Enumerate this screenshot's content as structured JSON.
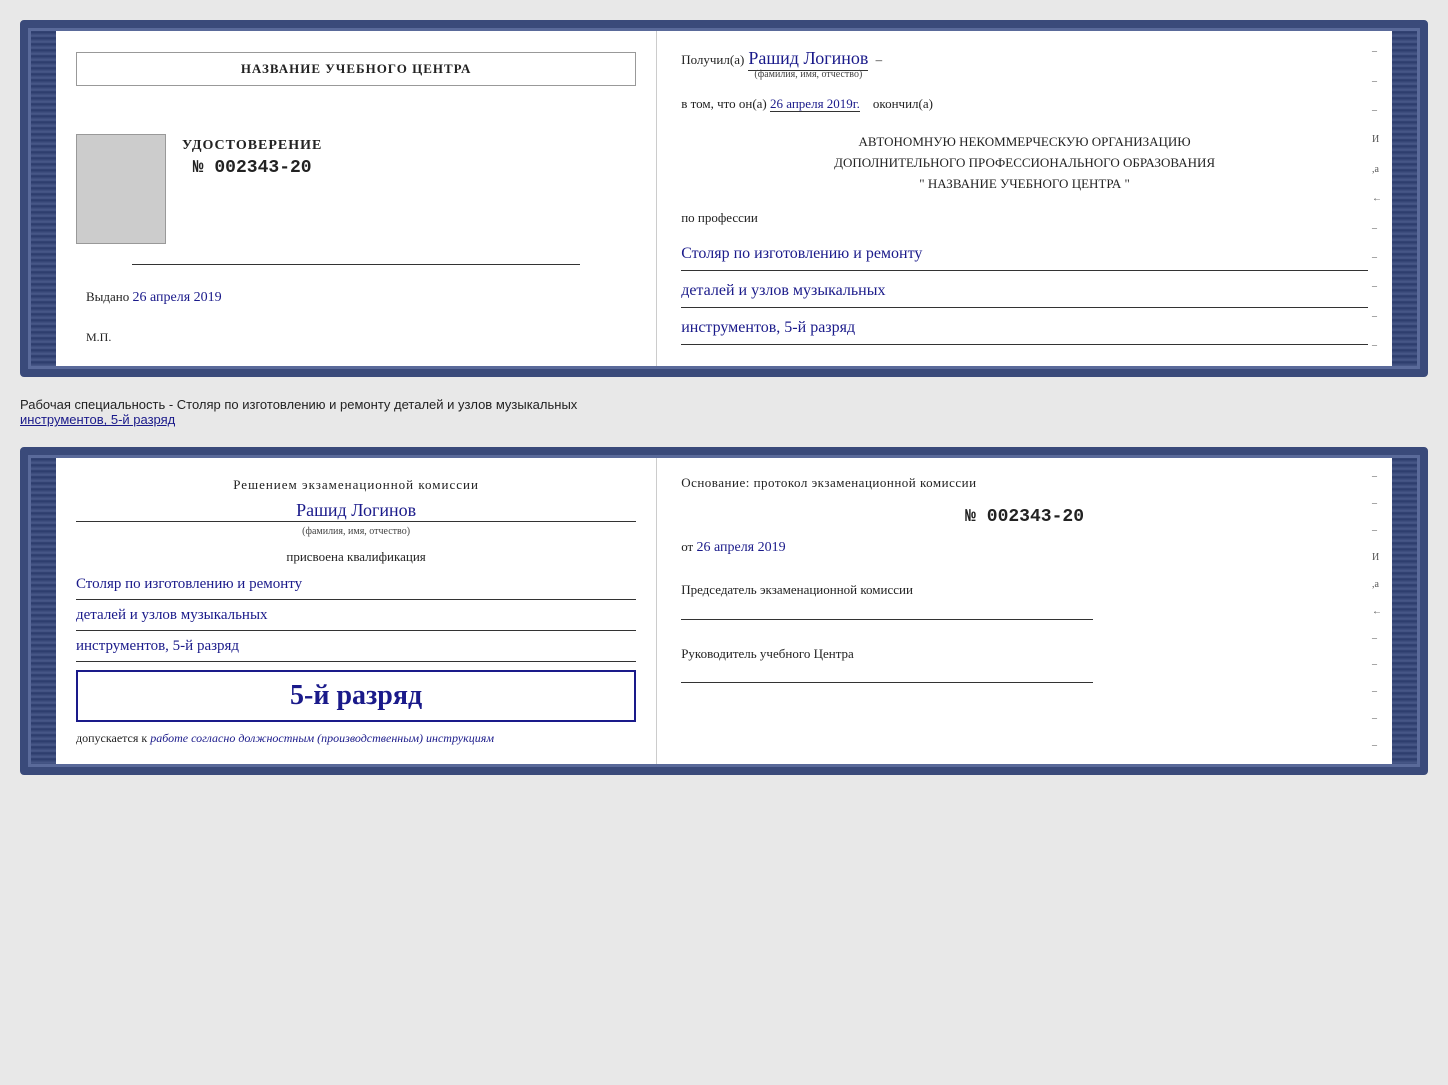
{
  "cert1": {
    "left": {
      "center_name": "НАЗВАНИЕ УЧЕБНОГО ЦЕНТРА",
      "udost_title": "УДОСТОВЕРЕНИЕ",
      "udost_number": "№ 002343-20",
      "vydano_label": "Выдано",
      "vydano_date": "26 апреля 2019",
      "mp": "М.П."
    },
    "right": {
      "poluchil_label": "Получил(а)",
      "name_handwritten": "Рашид Логинов",
      "fio_sub": "(фамилия, имя, отчество)",
      "vtom_label": "в том, что он(а)",
      "date_handwritten": "26 апреля 2019г.",
      "okonchil": "окончил(а)",
      "org_line1": "АВТОНОМНУЮ НЕКОММЕРЧЕСКУЮ ОРГАНИЗАЦИЮ",
      "org_line2": "ДОПОЛНИТЕЛЬНОГО ПРОФЕССИОНАЛЬНОГО ОБРАЗОВАНИЯ",
      "org_line3": "\"   НАЗВАНИЕ УЧЕБНОГО ЦЕНТРА   \"",
      "po_professii": "по профессии",
      "qual1": "Столяр по изготовлению и ремонту",
      "qual2": "деталей и узлов музыкальных",
      "qual3": "инструментов, 5-й разряд"
    }
  },
  "specialty_text": "Рабочая специальность - Столяр по изготовлению и ремонту деталей и узлов музыкальных",
  "specialty_text2": "инструментов, 5-й разряд",
  "cert2": {
    "left": {
      "resheniem": "Решением экзаменационной комиссии",
      "name_handwritten": "Рашид Логинов",
      "fio_sub": "(фамилия, имя, отчество)",
      "prisvoena": "присвоена квалификация",
      "qual1": "Столяр по изготовлению и ремонту",
      "qual2": "деталей и узлов музыкальных",
      "qual3": "инструментов, 5-й разряд",
      "rank": "5-й разряд",
      "dopuskaetsya": "допускается к",
      "dopusk_text": "работе согласно должностным (производственным) инструкциям"
    },
    "right": {
      "osnovanie": "Основание: протокол экзаменационной  комиссии",
      "protocol_num": "№  002343-20",
      "ot_label": "от",
      "ot_date": "26 апреля 2019",
      "predsedatel": "Председатель экзаменационной комиссии",
      "rukovoditel": "Руководитель учебного Центра"
    }
  },
  "deco": {
    "items": [
      "–",
      "–",
      "–",
      "И",
      ",а",
      "←",
      "–",
      "–",
      "–",
      "–",
      "–"
    ]
  }
}
